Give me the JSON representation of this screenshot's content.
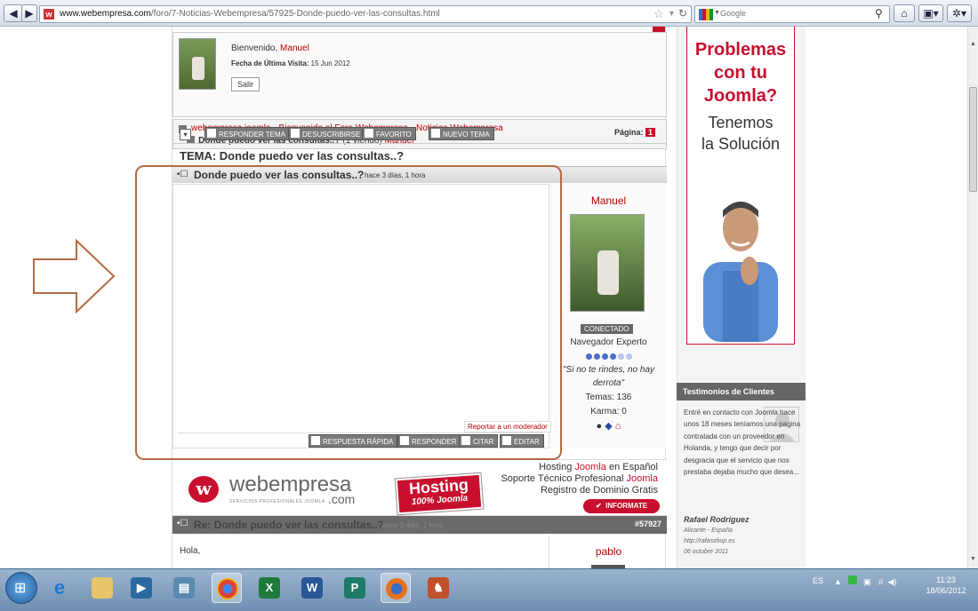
{
  "browser": {
    "url_domain": "www.webempresa.com",
    "url_path": "/foro/7-Noticias-Webempresa/57925-Donde-puedo-ver-las-consultas.html",
    "search_placeholder": "Google",
    "back_glyph": "◀",
    "forward_glyph": "▶",
    "home_glyph": "⌂"
  },
  "userbox": {
    "welcome": "Bienvenido,",
    "username": "Manuel",
    "last_visit_label": "Fecha de Última Visita:",
    "last_visit_date": "15 Jun 2012",
    "logout": "Salir"
  },
  "breadcrumb": {
    "items": [
      "webempresa joomla",
      "Bienvenido al Foro Webempresa",
      "Noticias Webempresa"
    ],
    "current_topic": "Donde puedo ver las consultas..?",
    "viewing": "(1 viendo)",
    "viewer": "Manuel"
  },
  "toolbar": {
    "reply_topic": "RESPONDER TEMA",
    "unsubscribe": "DESUSCRIBIRSE",
    "favorite": "FAVORITO",
    "new_topic": "NUEVO TEMA",
    "page_label": "Página:",
    "page_number": "1"
  },
  "topic": {
    "title": "TEMA: Donde puedo ver las consultas..?"
  },
  "post": {
    "subject": "Donde puedo ver las consultas..?",
    "time": "hace 3 días, 1 hora",
    "report": "Reportar a un moderador",
    "actions": {
      "quick_reply": "RESPUESTA RÁPIDA",
      "reply": "RESPONDER",
      "quote": "CITAR",
      "edit": "EDITAR"
    },
    "author": {
      "name": "Manuel",
      "status": "CONECTADO",
      "rank": "Navegador Experto",
      "quote_line1": "\"Si no te rindes, no hay",
      "quote_line2": "derrota\"",
      "topics": "Temas: 136",
      "karma": "Karma: 0"
    }
  },
  "banner": {
    "brand": "webempresa",
    "brand_sub": "SERVICIOS PROFESIONALES JOOMLA",
    "brand_tld": ".com",
    "hosting": "Hosting",
    "hosting_sub": "100% Joomla",
    "line1a": "Hosting",
    "line1b": "Joomla",
    "line1c": "en Español",
    "line2a": "Soporte Técnico Profesional",
    "line2b": "Joomla",
    "line3": "Registro de Dominio Gratis",
    "cta": "INFORMATE"
  },
  "reply": {
    "subject": "Re: Donde puedo ver las consultas..?",
    "time": "hace 3 días, 1 hora",
    "id": "#57927",
    "author": "pablo",
    "body": "Hola,"
  },
  "ad": {
    "line1": "Problemas",
    "line2": "con tu",
    "line3": "Joomla?",
    "line4": "Tenemos",
    "line5": "la Solución"
  },
  "testimonials": {
    "heading": "Testimonios de Clientes",
    "text": "Entré en contacto con Joomla hace unos 18 meses teníamos una pagina contratada con un proveedor en Holanda, y tengo que decir por desgracia que el servicio que nos prestaba dejaba mucho que desea...",
    "author": "Rafael Rodríguez",
    "location": "Alicante - España",
    "site": "http://rafasshop.es",
    "date": "06 octubre 2011"
  },
  "taskbar": {
    "language": "ES",
    "time": "11:23",
    "date": "18/06/2012"
  },
  "colors": {
    "brand_red": "#c8102e",
    "annotation": "#b56a43"
  }
}
